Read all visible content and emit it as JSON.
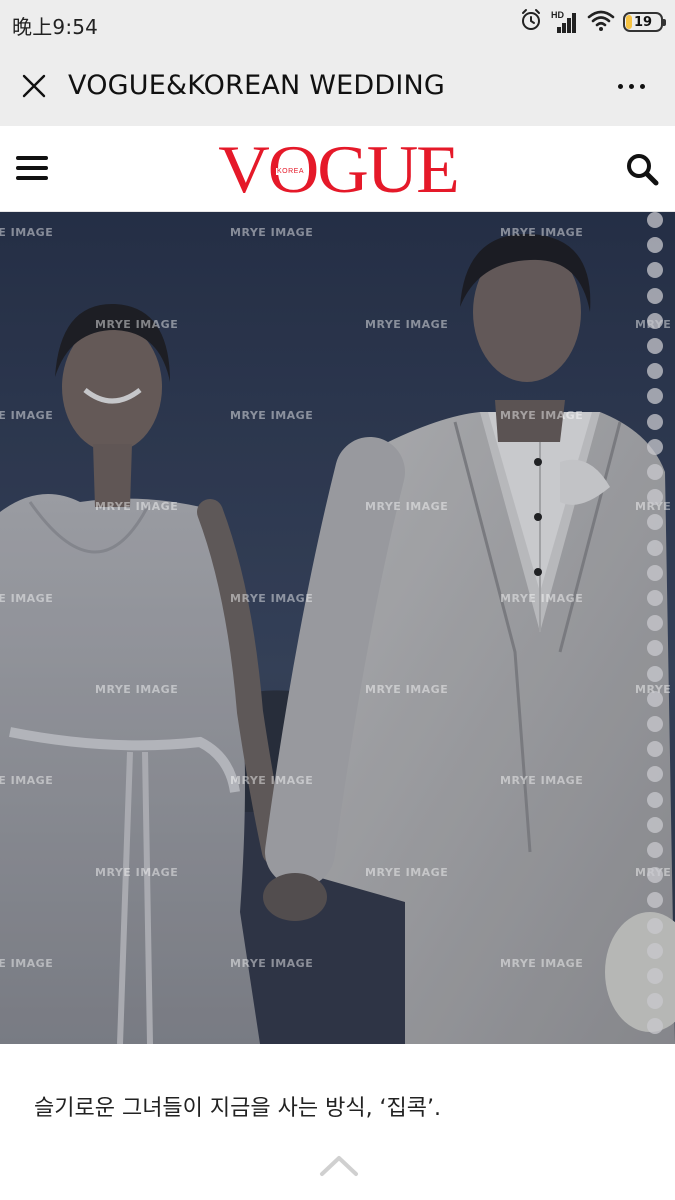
{
  "status_bar": {
    "time": "晚上9:54",
    "icons": [
      "alarm-icon",
      "hd-signal-icon",
      "wifi-icon",
      "battery-icon"
    ],
    "hd_label": "HD",
    "battery_level": "19",
    "battery_fraction": 0.19
  },
  "title_bar": {
    "title": "VOGUE&KOREAN WEDDING",
    "close_icon": "close-icon",
    "more_icon": "more-dots-icon"
  },
  "site_header": {
    "logo": "VOGUE",
    "logo_sub": "KOREA",
    "menu_icon": "hamburger-menu-icon",
    "search_icon": "search-icon",
    "brand_color": "#e51929"
  },
  "hero": {
    "watermark": "MRYE IMAGE"
  },
  "article": {
    "caption": "슬기로운 그녀들이 지금을 사는 방식, ‘집콕’."
  },
  "scroll_top_icon": "chevron-up-icon"
}
